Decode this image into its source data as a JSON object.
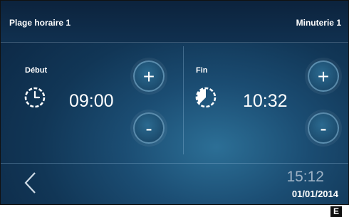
{
  "header": {
    "left_title": "Plage horaire 1",
    "right_title": "Minuterie 1"
  },
  "start": {
    "label": "Début",
    "time": "09:00",
    "plus_label": "+",
    "minus_label": "-"
  },
  "end": {
    "label": "Fin",
    "time": "10:32",
    "plus_label": "+",
    "minus_label": "-"
  },
  "footer": {
    "time": "15:12",
    "date": "01/01/2014"
  },
  "badge": "E",
  "colors": {
    "background": "#113656",
    "accent": "#2b6a90",
    "text": "#ffffff"
  }
}
